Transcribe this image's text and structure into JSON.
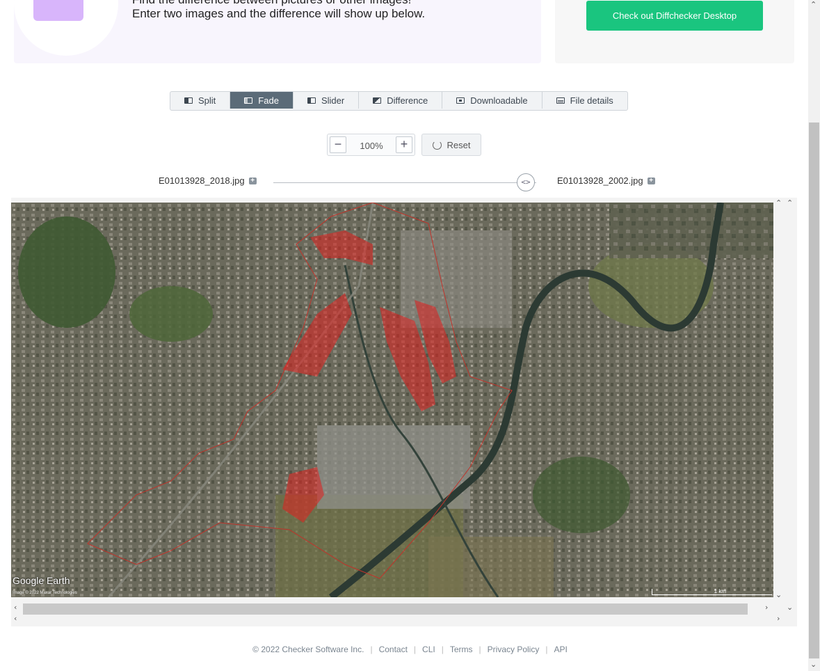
{
  "hero": {
    "line1": "Find the difference between pictures or other images!",
    "line2": "Enter two images and the difference will show up below.",
    "cta_label": "Check out Diffchecker Desktop"
  },
  "tabs": [
    {
      "label": "Split",
      "icon": "split-view-icon",
      "active": false
    },
    {
      "label": "Fade",
      "icon": "fade-view-icon",
      "active": true
    },
    {
      "label": "Slider",
      "icon": "slider-view-icon",
      "active": false
    },
    {
      "label": "Difference",
      "icon": "difference-view-icon",
      "active": false
    },
    {
      "label": "Downloadable",
      "icon": "downloadable-view-icon",
      "active": false
    },
    {
      "label": "File details",
      "icon": "file-details-icon",
      "active": false
    }
  ],
  "zoom": {
    "minus": "−",
    "value": "100%",
    "plus": "+",
    "reset_label": "Reset"
  },
  "files": {
    "left": "E01013928_2018.jpg",
    "right": "E01013928_2002.jpg",
    "slider_glyph": "<>",
    "add_glyph": "+"
  },
  "map": {
    "logo": "Google Earth",
    "attribution": "Image © 2022 Maxar Technologies",
    "scale": "1 km"
  },
  "scroll": {
    "up": "⌃",
    "down": "⌄",
    "left": "‹",
    "right": "›"
  },
  "footer": {
    "copyright": "© 2022 Checker Software Inc.",
    "links": [
      "Contact",
      "CLI",
      "Terms",
      "Privacy Policy",
      "API"
    ]
  },
  "colors": {
    "cta": "#1ac57f",
    "active_tab": "#5b6b78",
    "diff_overlay": "#e2201f"
  }
}
